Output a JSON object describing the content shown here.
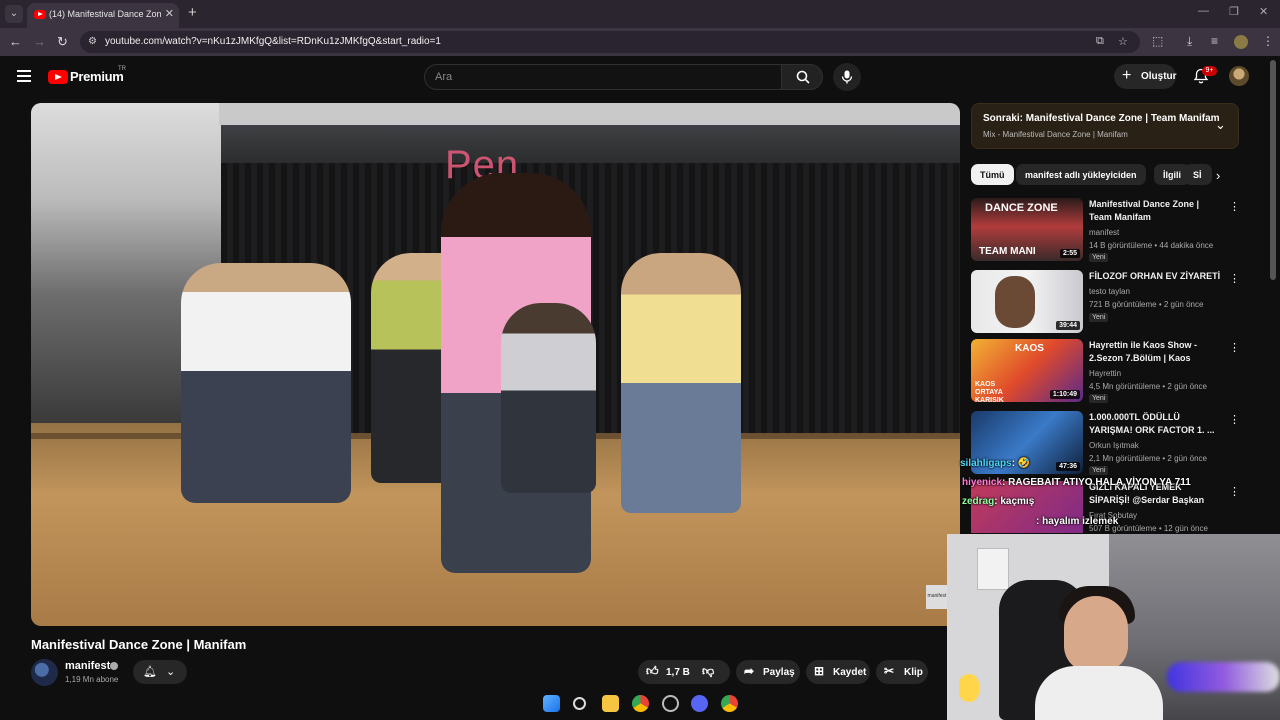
{
  "browser": {
    "tab_title": "(14) Manifestival Dance Zone | Ma",
    "url": "youtube.com/watch?v=nKu1zJMKfgQ&list=RDnKu1zJMKfgQ&start_radio=1"
  },
  "header": {
    "logo": "Premium",
    "country": "TR",
    "search_placeholder": "Ara",
    "create_label": "Oluştur",
    "notif_badge": "9+"
  },
  "video": {
    "title": "Manifestival Dance Zone | Manifam",
    "neon_sign": "Pen",
    "watermark": "manifest",
    "channel": "manifest",
    "subscribers": "1,19 Mn abone",
    "likes": "1,7 B",
    "share": "Paylaş",
    "save": "Kaydet",
    "clip": "Klip"
  },
  "up_next": {
    "title": "Sonraki: Manifestival Dance Zone | Team Manifam",
    "subtitle": "Mix - Manifestival Dance Zone | Manifam"
  },
  "chips": [
    "Tümü",
    "manifest adlı yükleyiciden",
    "İlgili",
    "Sİ"
  ],
  "related": [
    {
      "title": "Manifestival Dance Zone | Team Manifam",
      "channel": "manifest",
      "meta": "14 B görüntüleme • 44 dakika önce",
      "badge": "Yeni",
      "duration": "2:55",
      "thumb_text": "DANCE ZONE",
      "thumb_text2": "TEAM MANI"
    },
    {
      "title": "FİLOZOF ORHAN EV ZİYARETİ",
      "channel": "testo taylan",
      "meta": "721 B görüntüleme • 2 gün önce",
      "badge": "Yeni",
      "duration": "39:44"
    },
    {
      "title": "Hayrettin ile Kaos Show - 2.Sezon 7.Bölüm | Kaos Ortay...",
      "channel": "Hayrettin",
      "meta": "4,5 Mn görüntüleme • 2 gün önce",
      "badge": "Yeni",
      "duration": "1:10:49",
      "thumb_text": "KAOS",
      "thumb_text2": "KAOS ORTAYA KARIŞIK"
    },
    {
      "title": "1.000.000TL ÖDÜLLÜ YARIŞMA! ORK FACTOR 1. ...",
      "channel": "Orkun Işıtmak",
      "meta": "2,1 Mn görüntüleme • 2 gün önce",
      "badge": "Yeni",
      "duration": "47:36"
    },
    {
      "title": "GIZLI KAPALI YEMEK SİPARİŞİ! @Serdar Başkan @Melih Abuaf",
      "channel": "Fırat Sobutay",
      "meta": "507 B görüntüleme • 12 gün önce"
    }
  ],
  "chat": [
    {
      "user": "silahligaps",
      "msg": ": 🤣"
    },
    {
      "user": "hiyenick",
      "msg": ": RAGEBAIT ATIYO HALA VİYON YA 711"
    },
    {
      "user": "zedrag",
      "msg": ": kaçmış"
    },
    {
      "user": "",
      "msg": ": hayalım izlemek"
    }
  ],
  "colors": {
    "bg": "#0f0f0f",
    "accent": "#ff0000",
    "chip_active": "#f1f1f1"
  }
}
